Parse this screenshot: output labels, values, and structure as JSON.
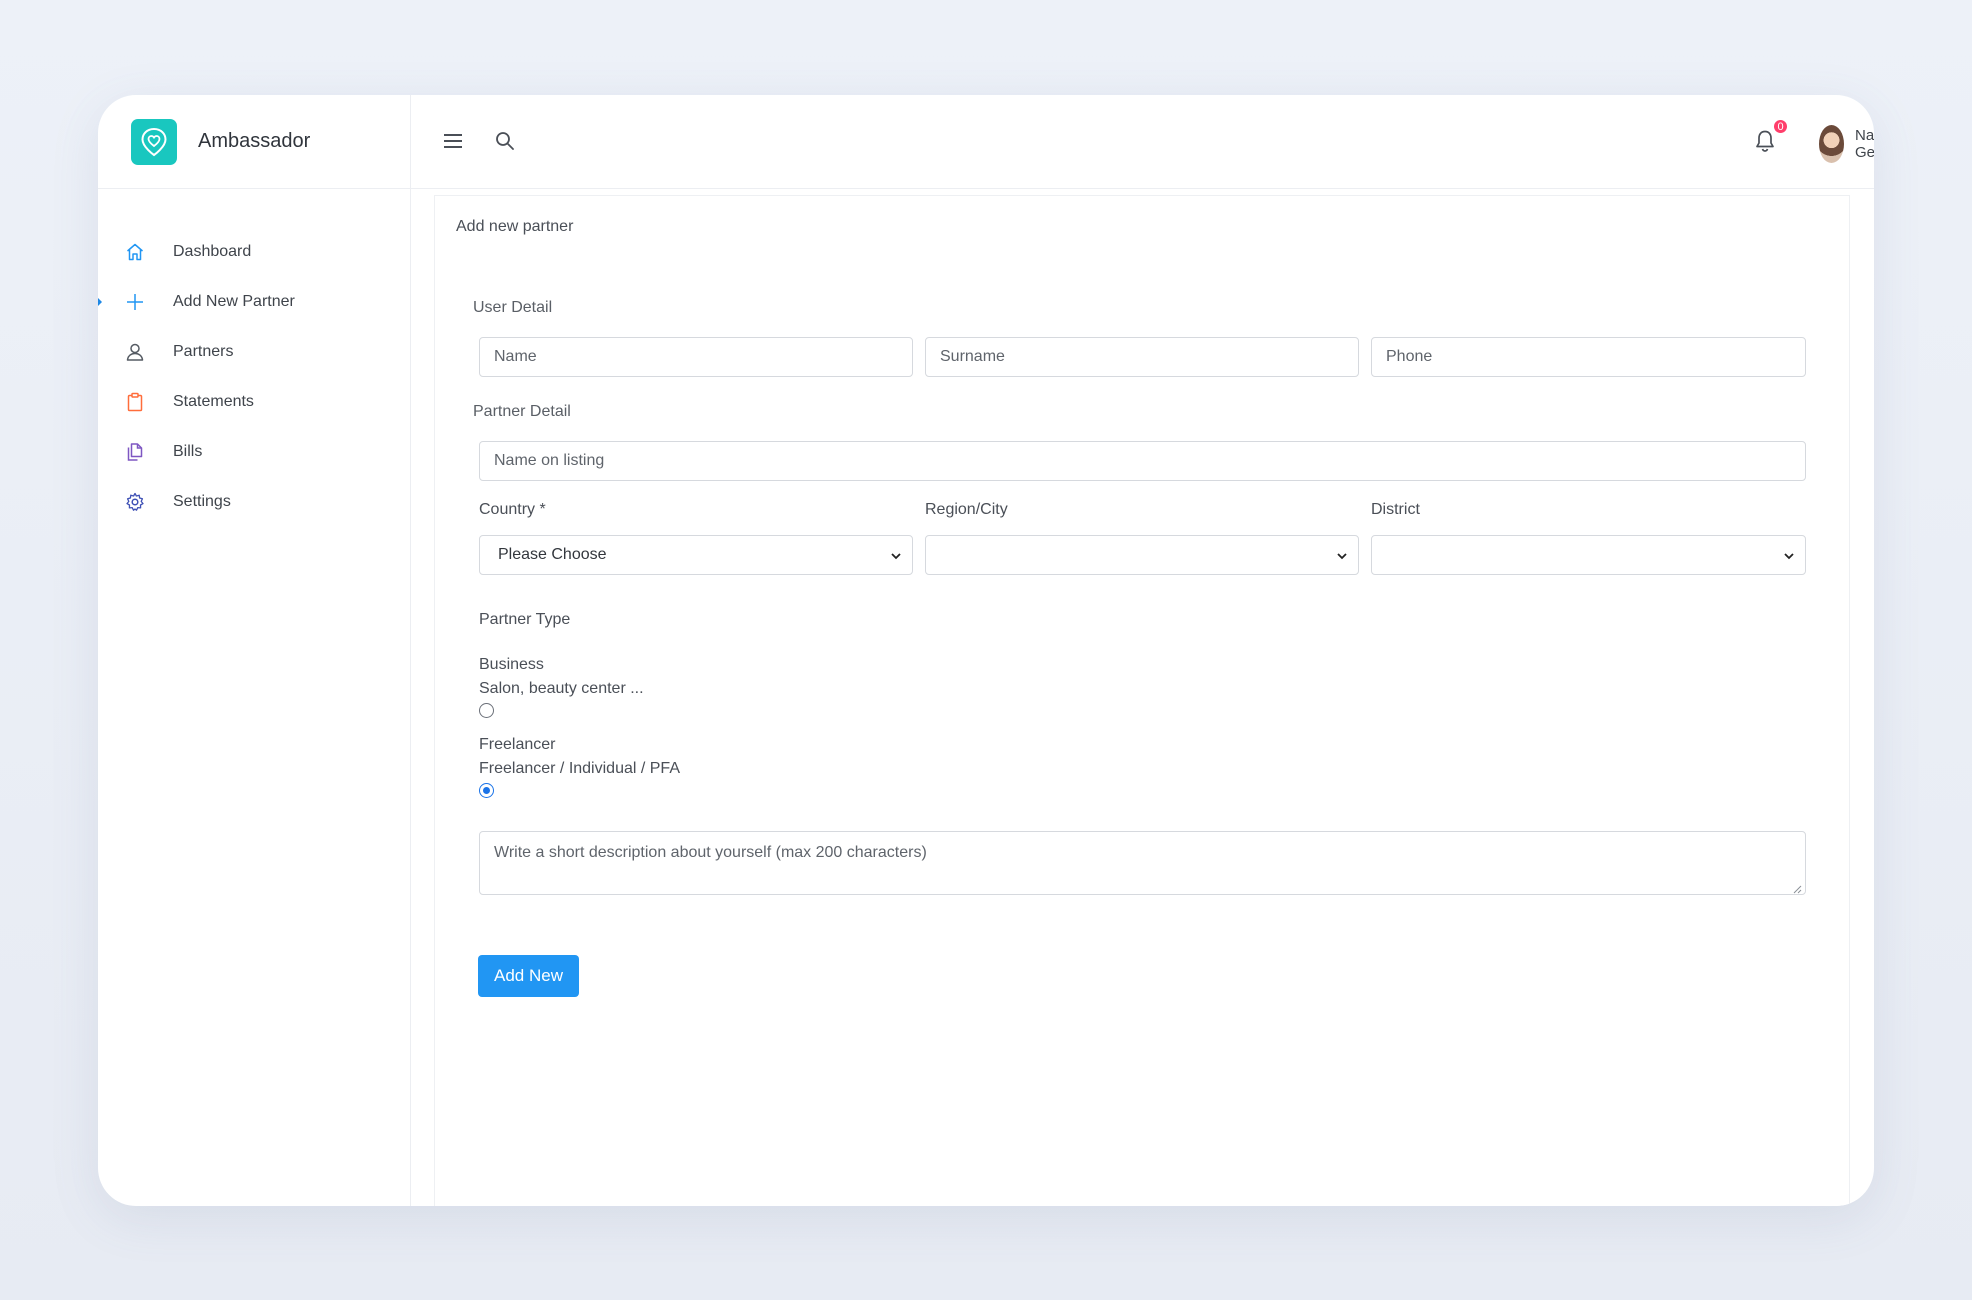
{
  "app": {
    "brand_name": "Ambassador",
    "brand_color": "#19c7bf"
  },
  "sidebar": {
    "items": [
      {
        "label": "Dashboard",
        "icon": "home-icon",
        "color": "#2196f3"
      },
      {
        "label": "Add New Partner",
        "icon": "plus-icon",
        "color": "#2196f3",
        "active": true
      },
      {
        "label": "Partners",
        "icon": "user-icon",
        "color": "#555b63"
      },
      {
        "label": "Statements",
        "icon": "clipboard-icon",
        "color": "#ff6d3b"
      },
      {
        "label": "Bills",
        "icon": "documents-icon",
        "color": "#7e57c2"
      },
      {
        "label": "Settings",
        "icon": "gear-icon",
        "color": "#3f51b5"
      }
    ]
  },
  "topbar": {
    "menu_icon": "hamburger-icon",
    "search_icon": "search-icon",
    "notification_count": "0",
    "user_name": "Nazlı Genç"
  },
  "form": {
    "page_title": "Add new partner",
    "user_detail_label": "User Detail",
    "name_placeholder": "Name",
    "surname_placeholder": "Surname",
    "phone_placeholder": "Phone",
    "partner_detail_label": "Partner Detail",
    "listing_placeholder": "Name on listing",
    "country_label": "Country *",
    "country_value": "Please Choose",
    "region_label": "Region/City",
    "region_value": "",
    "district_label": "District",
    "district_value": "",
    "partner_type_label": "Partner Type",
    "business_title": "Business",
    "business_desc": "Salon, beauty center ...",
    "freelancer_title": "Freelancer",
    "freelancer_desc": "Freelancer / Individual / PFA",
    "selected_type": "freelancer",
    "description_placeholder": "Write a short description about yourself (max 200 characters)",
    "submit_label": "Add New",
    "accent_color": "#2196f3"
  }
}
